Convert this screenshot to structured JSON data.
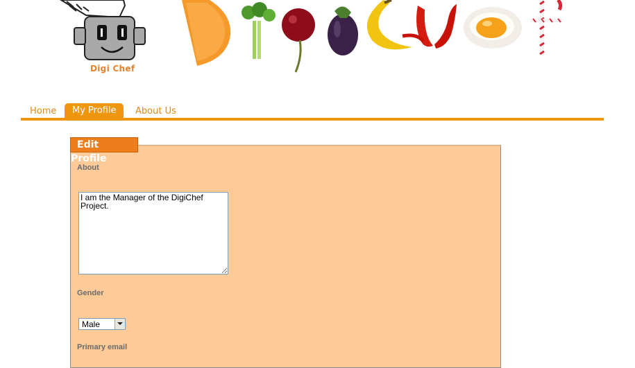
{
  "brand": {
    "logo_caption": "Digi Chef"
  },
  "nav": {
    "tabs": [
      {
        "label": "Home",
        "active": false
      },
      {
        "label": "My Profile",
        "active": true
      },
      {
        "label": "About Us",
        "active": false
      }
    ]
  },
  "panel": {
    "heading": "Edit Profile",
    "about_label": "About",
    "about_value": "I am the Manager of the DigiChef Project.",
    "gender_label": "Gender",
    "gender_value": "Male",
    "email_label": "Primary email"
  },
  "colors": {
    "accent": "#f0960e",
    "panel_bg": "#fdca98",
    "heading_bg": "#ee7e1c"
  }
}
